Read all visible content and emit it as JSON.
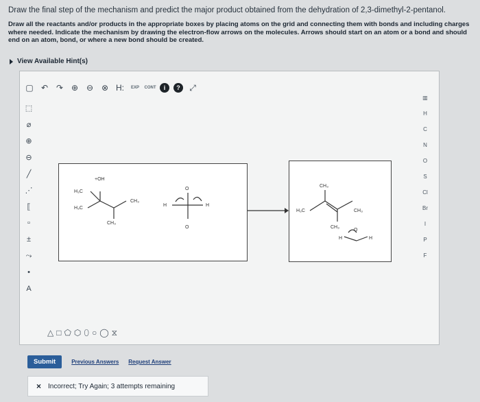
{
  "question": {
    "title": "Draw the final step of the mechanism and predict the major product obtained from the dehydration of 2,3-dimethyl-2-pentanol.",
    "instructions": "Draw all the reactants and/or products in the appropriate boxes by placing atoms on the grid and connecting them with bonds and including charges where needed. Indicate the mechanism by drawing the electron-flow arrows on the molecules. Arrows should start on an atom or a bond and should end on an atom, bond, or where a new bond should be created."
  },
  "hint": {
    "label": "View Available Hint(s)"
  },
  "toolbar": {
    "exp_label": "EXP",
    "cont_label": "CONT",
    "info_label": "?",
    "h_label": "H:"
  },
  "elements": [
    "H",
    "C",
    "N",
    "O",
    "S",
    "Cl",
    "Br",
    "I",
    "P",
    "F"
  ],
  "molecule_labels": {
    "left": {
      "oh": "+OH",
      "h3c_top": "H₃C",
      "ch3_right": "CH₃",
      "h3c_left": "H₃C",
      "ch3_bottom": "CH₃"
    },
    "right": {
      "ch3_top": "CH₃",
      "h3c": "H₃C",
      "ch3_right": "CH₃",
      "ch3_bottom": "CH₃"
    },
    "water": {
      "o": "O",
      "h": "H"
    }
  },
  "left_tool_caption": "A",
  "actions": {
    "submit": "Submit",
    "previous": "Previous Answers",
    "request": "Request Answer"
  },
  "feedback": {
    "icon": "×",
    "text": "Incorrect; Try Again; 3 attempts remaining"
  }
}
